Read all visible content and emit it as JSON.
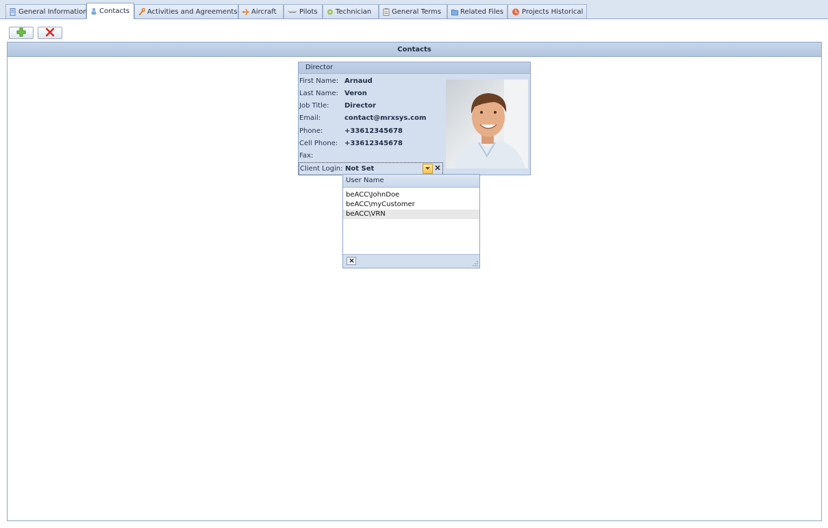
{
  "tabs": [
    {
      "label": "General Information",
      "icon": "document-icon"
    },
    {
      "label": "Contacts",
      "icon": "contact-icon"
    },
    {
      "label": "Activities and Agreements",
      "icon": "wrench-icon"
    },
    {
      "label": "Aircraft",
      "icon": "airplane-icon"
    },
    {
      "label": "Pilots",
      "icon": "wings-icon"
    },
    {
      "label": "Technician",
      "icon": "gear-icon"
    },
    {
      "label": "General Terms",
      "icon": "clipboard-icon"
    },
    {
      "label": "Related Files",
      "icon": "folder-icon"
    },
    {
      "label": "Projects Historical",
      "icon": "history-icon"
    }
  ],
  "active_tab": "Contacts",
  "toolbar": {
    "add_icon": "plus-icon",
    "delete_icon": "x-icon"
  },
  "panel": {
    "title": "Contacts"
  },
  "card": {
    "title": "Director",
    "fields": [
      {
        "label": "First Name:",
        "value": "Arnaud"
      },
      {
        "label": "Last Name:",
        "value": "Veron"
      },
      {
        "label": "Job Title:",
        "value": "Director"
      },
      {
        "label": "Email:",
        "value": "contact@mrxsys.com"
      },
      {
        "label": "Phone:",
        "value": "+33612345678"
      },
      {
        "label": "Cell Phone:",
        "value": "+33612345678"
      },
      {
        "label": "Fax:",
        "value": ""
      }
    ],
    "client_login": {
      "label": "Client Login:",
      "value": "Not Set"
    }
  },
  "dropdown": {
    "column_header": "User Name",
    "items": [
      "beACC\\JohnDoe",
      "beACC\\myCustomer",
      "beACC\\VRN"
    ],
    "highlighted_index": 2
  },
  "colors": {
    "accent": "#8ea6c8",
    "header": "#b3c5df",
    "card": "#d3deef",
    "combo_button": "#f7c34e"
  }
}
